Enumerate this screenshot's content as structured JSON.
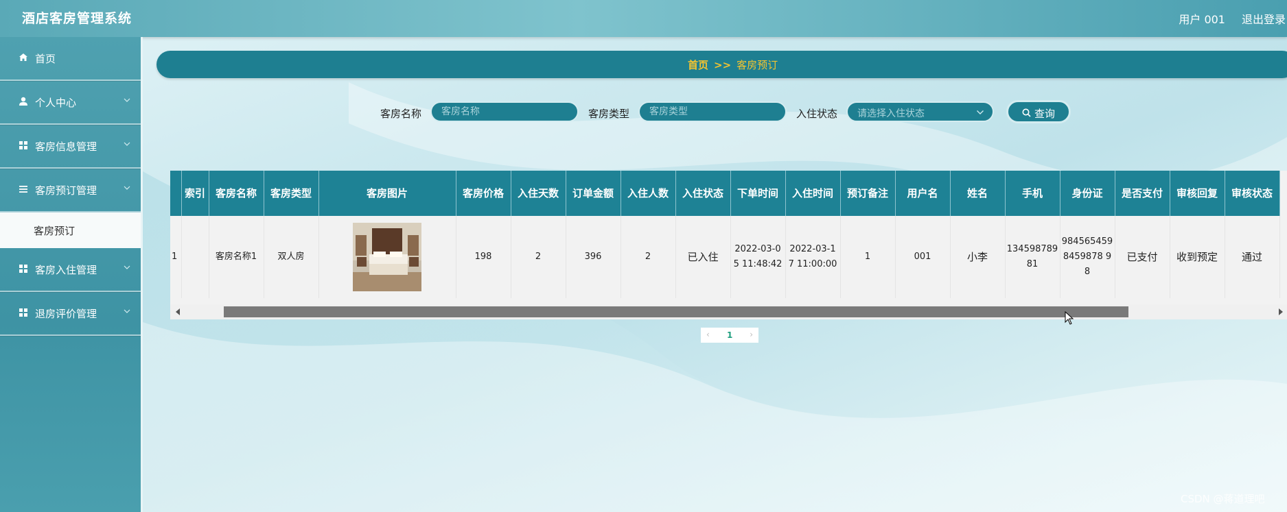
{
  "header": {
    "title": "酒店客房管理系统",
    "user_text": "用户 001",
    "logout_label": "退出登录"
  },
  "sidebar": {
    "items": [
      {
        "label": "首页",
        "icon": "home-icon",
        "expandable": false
      },
      {
        "label": "个人中心",
        "icon": "user-icon",
        "expandable": true
      },
      {
        "label": "客房信息管理",
        "icon": "grid-icon",
        "expandable": true
      },
      {
        "label": "客房预订管理",
        "icon": "list-icon",
        "expandable": true,
        "submenu": [
          "客房预订"
        ]
      },
      {
        "label": "客房入住管理",
        "icon": "grid-icon",
        "expandable": true
      },
      {
        "label": "退房评价管理",
        "icon": "grid-icon",
        "expandable": true
      }
    ]
  },
  "breadcrumb": {
    "home": "首页",
    "separator": ">>",
    "current": "客房预订"
  },
  "search": {
    "room_name_label": "客房名称",
    "room_name_placeholder": "客房名称",
    "room_type_label": "客房类型",
    "room_type_placeholder": "客房类型",
    "status_label": "入住状态",
    "status_placeholder": "请选择入住状态",
    "query_label": "查询"
  },
  "table": {
    "columns": [
      "索引",
      "客房名称",
      "客房类型",
      "客房图片",
      "客房价格",
      "入住天数",
      "订单金额",
      "入住人数",
      "入住状态",
      "下单时间",
      "入住时间",
      "预订备注",
      "用户名",
      "姓名",
      "手机",
      "身份证",
      "是否支付",
      "审核回复",
      "审核状态"
    ],
    "rows": [
      {
        "index": "1",
        "room_name": "客房名称1",
        "room_type": "双人房",
        "price": "198",
        "days": "2",
        "amount": "396",
        "guests": "2",
        "status": "已入住",
        "order_time": "2022-03-05 11:48:42",
        "checkin_time": "2022-03-17 11:00:00",
        "remark": "1",
        "username": "001",
        "name": "小李",
        "phone": "13459878981",
        "id_card": "9845654598459878 98",
        "paid": "已支付",
        "review_reply": "收到预定",
        "review_status": "通过"
      }
    ]
  },
  "pagination": {
    "current": "1"
  },
  "watermark": "CSDN @蒋道理吧",
  "colors": {
    "primary": "#1e8295",
    "accent": "#f4c430",
    "sidebar": "#4fa1b0"
  }
}
